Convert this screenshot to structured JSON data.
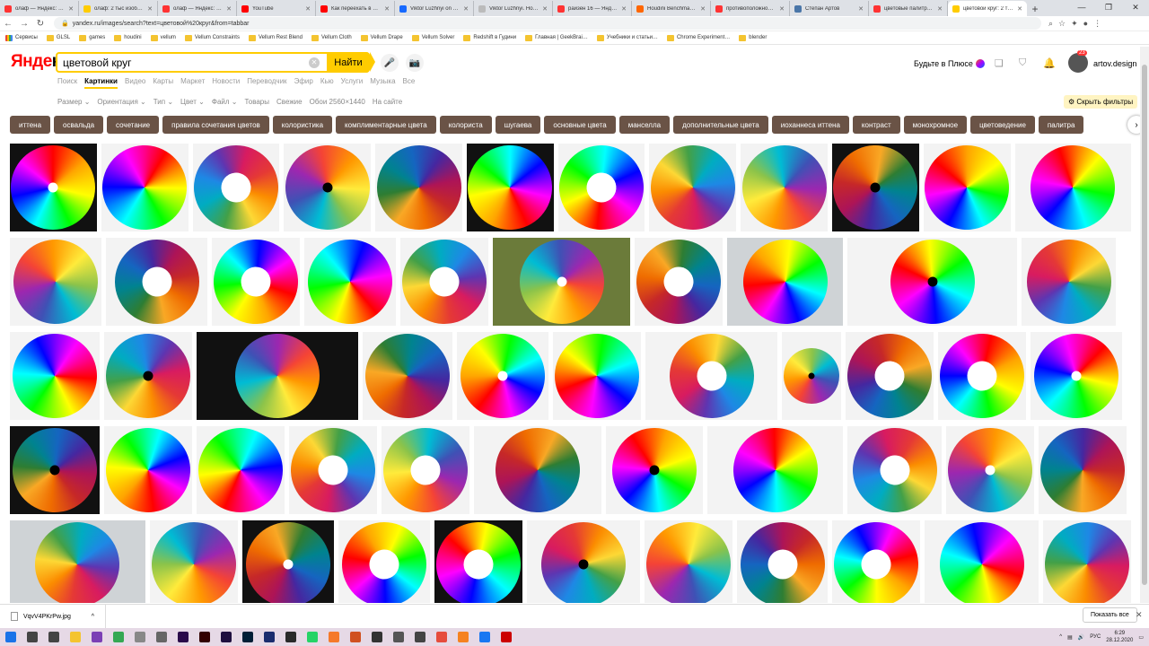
{
  "browser": {
    "tabs": [
      {
        "title": "олаф — Яндекс: нашл…",
        "favicon": "yandex-icon",
        "color": "#f33"
      },
      {
        "title": "олаф: 2 тыс изображ…",
        "favicon": "yandex-images-icon",
        "color": "#fc0"
      },
      {
        "title": "олаф — Яндекс: наш…",
        "favicon": "yandex-icon",
        "color": "#f33"
      },
      {
        "title": "YouTube",
        "favicon": "youtube-icon",
        "color": "#f00"
      },
      {
        "title": "Как переехать в Ниде…",
        "favicon": "youtube-icon",
        "color": "#f00"
      },
      {
        "title": "Viktor Luzhnyi on Bé…",
        "favicon": "behance-icon",
        "color": "#1769ff"
      },
      {
        "title": "Viktor Luzhnyi. Houdi…",
        "favicon": "page-icon",
        "color": "#bbb"
      },
      {
        "title": "райзен 16 — Яндекс…",
        "favicon": "yandex-icon",
        "color": "#f33"
      },
      {
        "title": "Houdini Benchmark |…",
        "favicon": "houdini-icon",
        "color": "#f60"
      },
      {
        "title": "противоположность…",
        "favicon": "yandex-icon",
        "color": "#f33"
      },
      {
        "title": "Степан Артов",
        "favicon": "vk-icon",
        "color": "#4a76a8"
      },
      {
        "title": "цветовые палитры —…",
        "favicon": "yandex-icon",
        "color": "#f33"
      },
      {
        "title": "цветовой круг: 2 тыс…",
        "favicon": "yandex-images-icon",
        "color": "#fc0"
      }
    ],
    "url": "yandex.ru/images/search?text=цветовой%20круг&from=tabbar",
    "bookmarks": [
      "Сервисы",
      "GLSL",
      "games",
      "houdini",
      "vellum",
      "Vellum Constraints",
      "Vellum Rest Blend",
      "Vellum Cloth",
      "Vellum Drape",
      "Vellum Solver",
      "Redshift в Гудини",
      "Главная | GeekBrai…",
      "Учебники и статьи…",
      "Chrome Experiment…",
      "blender"
    ]
  },
  "yandex": {
    "logo_main": "Янде",
    "logo_accent": "кс",
    "query": "цветовой круг",
    "find_label": "Найти",
    "plus_label": "Будьте в Плюсе",
    "notifications": "23",
    "username": "artov.design",
    "services": [
      "Поиск",
      "Картинки",
      "Видео",
      "Карты",
      "Маркет",
      "Новости",
      "Переводчик",
      "Эфир",
      "Кью",
      "Услуги",
      "Музыка",
      "Все"
    ],
    "active_service": 1,
    "filters": [
      "Размер ⌄",
      "Ориентация ⌄",
      "Тип ⌄",
      "Цвет ⌄",
      "Файл ⌄",
      "Товары",
      "Свежие",
      "Обои 2560×1440",
      "На сайте"
    ],
    "hide_filters": "Скрыть фильтры",
    "chips": [
      "иттена",
      "освальда",
      "сочетание",
      "правила сочетания цветов",
      "колористика",
      "комплиментарные цвета",
      "колориста",
      "шугаева",
      "основные цвета",
      "манселла",
      "дополнительные цвета",
      "иоханнеса иттена",
      "контраст",
      "монохромное",
      "цветоведение",
      "палитра"
    ]
  },
  "downloads": {
    "file": "VqvV4PKrPw.jpg",
    "show_all": "Показать все"
  },
  "taskbar": {
    "lang": "РУС",
    "time": "6:29",
    "date": "28.12.2020"
  }
}
